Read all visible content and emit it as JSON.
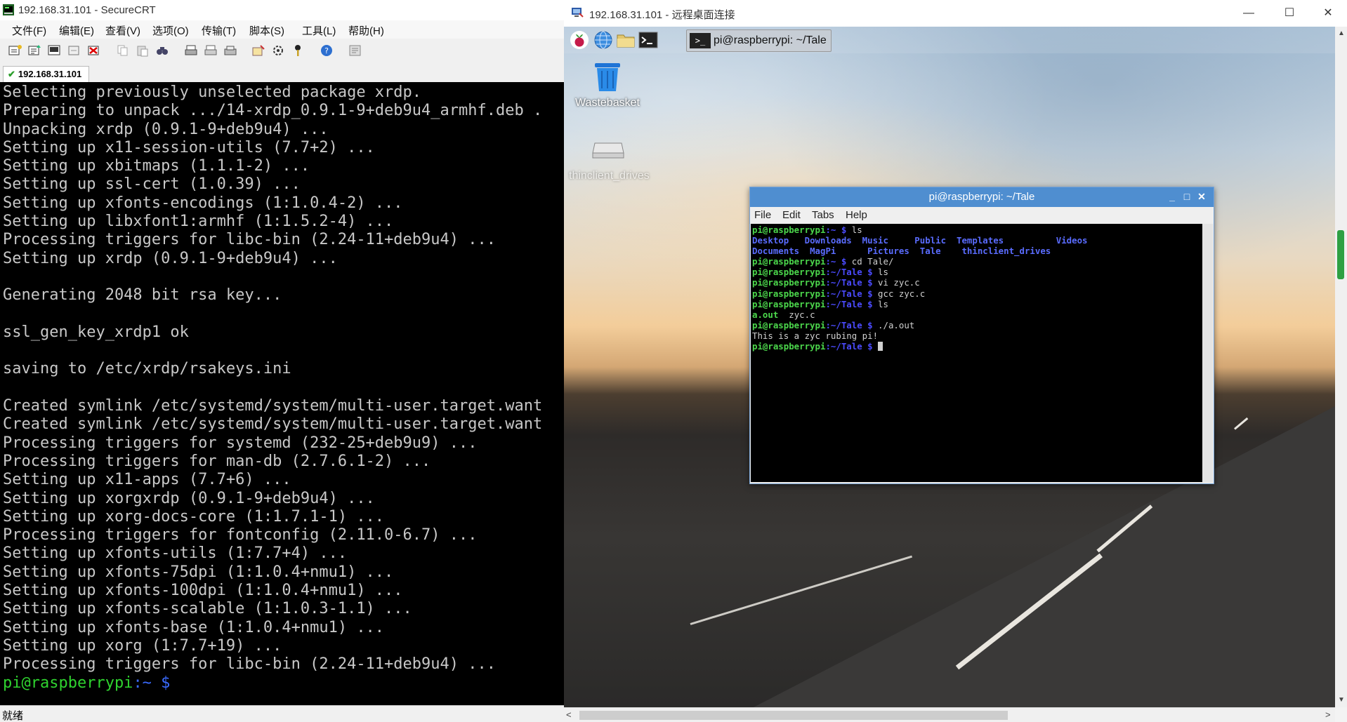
{
  "securecrt": {
    "title": "192.168.31.101 - SecureCRT",
    "menu": [
      "文件(F)",
      "编辑(E)",
      "查看(V)",
      "选项(O)",
      "传输(T)",
      "脚本(S)",
      "工具(L)",
      "帮助(H)"
    ],
    "tab_label": "192.168.31.101",
    "status": "就绪",
    "terminal_lines": [
      "Selecting previously unselected package xrdp.",
      "Preparing to unpack .../14-xrdp_0.9.1-9+deb9u4_armhf.deb .",
      "Unpacking xrdp (0.9.1-9+deb9u4) ...",
      "Setting up x11-session-utils (7.7+2) ...",
      "Setting up xbitmaps (1.1.1-2) ...",
      "Setting up ssl-cert (1.0.39) ...",
      "Setting up xfonts-encodings (1:1.0.4-2) ...",
      "Setting up libxfont1:armhf (1:1.5.2-4) ...",
      "Processing triggers for libc-bin (2.24-11+deb9u4) ...",
      "Setting up xrdp (0.9.1-9+deb9u4) ...",
      "",
      "Generating 2048 bit rsa key...",
      "",
      "ssl_gen_key_xrdp1 ok",
      "",
      "saving to /etc/xrdp/rsakeys.ini",
      "",
      "Created symlink /etc/systemd/system/multi-user.target.want",
      "Created symlink /etc/systemd/system/multi-user.target.want",
      "Processing triggers for systemd (232-25+deb9u9) ...",
      "Processing triggers for man-db (2.7.6.1-2) ...",
      "Setting up x11-apps (7.7+6) ...",
      "Setting up xorgxrdp (0.9.1-9+deb9u4) ...",
      "Setting up xorg-docs-core (1:1.7.1-1) ...",
      "Processing triggers for fontconfig (2.11.0-6.7) ...",
      "Setting up xfonts-utils (1:7.7+4) ...",
      "Setting up xfonts-75dpi (1:1.0.4+nmu1) ...",
      "Setting up xfonts-100dpi (1:1.0.4+nmu1) ...",
      "Setting up xfonts-scalable (1:1.0.3-1.1) ...",
      "Setting up xfonts-base (1:1.0.4+nmu1) ...",
      "Setting up xorg (1:7.7+19) ...",
      "Processing triggers for libc-bin (2.24-11+deb9u4) ..."
    ],
    "prompt_user": "pi@raspberrypi",
    "prompt_path": ":~ $"
  },
  "rdp": {
    "title": "192.168.31.101 - 远程桌面连接",
    "taskbar_window_label": "pi@raspberrypi: ~/Tale",
    "desktop_icons": [
      "Wastebasket",
      "thinclient_drives"
    ],
    "terminal": {
      "title": "pi@raspberrypi: ~/Tale",
      "menu": [
        "File",
        "Edit",
        "Tabs",
        "Help"
      ],
      "prompt_home": "pi@raspberrypi",
      "suffix_home": ":~ $",
      "suffix_tale": ":~/Tale $",
      "cmd_ls": " ls",
      "dirs_row1": [
        "Desktop",
        "Downloads",
        "Music",
        "Public",
        "Templates",
        "Videos"
      ],
      "dirs_row2": [
        "Documents",
        "MagPi",
        "Pictures",
        "Tale",
        "thinclient_drives"
      ],
      "cmd_cd": " cd Tale/",
      "cmd_vi": " vi zyc.c",
      "cmd_gcc": " gcc zyc.c",
      "file_aout": "a.out",
      "file_zyc": "  zyc.c",
      "cmd_run": " ./a.out",
      "output": "This is a zyc rubing pi!"
    }
  },
  "icons": {
    "crt_app": "securecrt-icon",
    "rdp_app": "remote-desktop-icon",
    "raspberry": "raspberry-menu-icon",
    "browser": "globe-icon",
    "files": "folder-icon",
    "terminal": "terminal-icon",
    "trash": "trash-icon",
    "drive": "drive-icon"
  },
  "colors": {
    "prompt_green": "#2fd32f",
    "path_blue": "#3a6bff",
    "lx_title_blue": "#4f8ed0"
  }
}
